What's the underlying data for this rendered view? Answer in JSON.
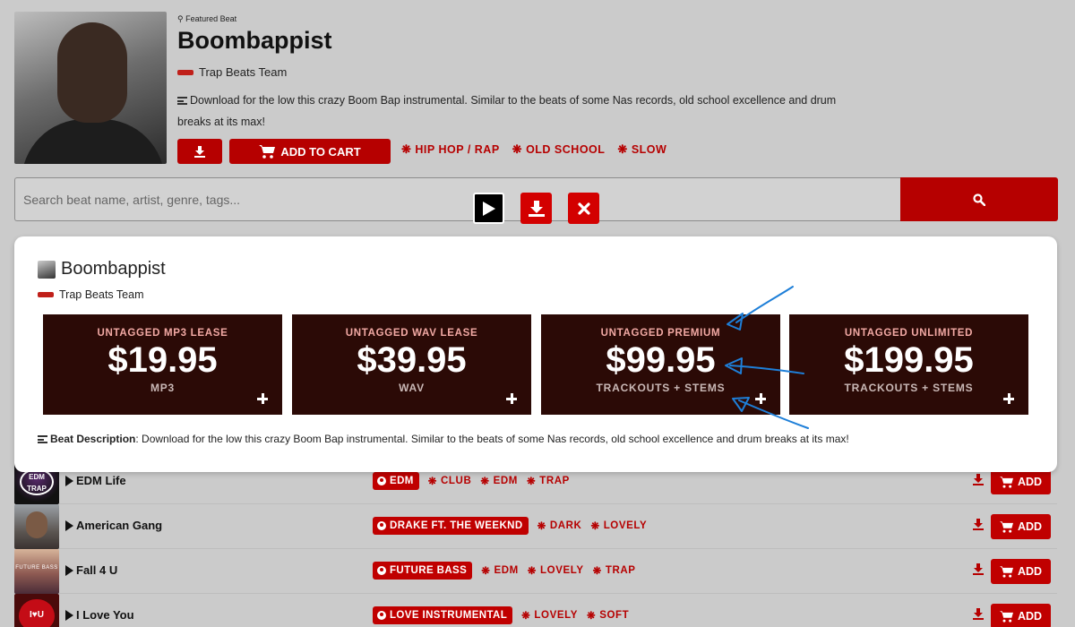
{
  "featured": {
    "label": "Featured Beat",
    "title": "Boombappist",
    "producer": "Trap Beats Team",
    "description": "Download for the low this crazy Boom Bap instrumental. Similar to the beats of some Nas records, old school excellence and drum breaks at its max!",
    "add_to_cart_label": "ADD TO CART",
    "tags": [
      "HIP HOP / RAP",
      "OLD SCHOOL",
      "SLOW"
    ]
  },
  "search": {
    "placeholder": "Search beat name, artist, genre, tags..."
  },
  "modal": {
    "title": "Boombappist",
    "producer": "Trap Beats Team",
    "leases": [
      {
        "name": "UNTAGGED MP3 LEASE",
        "price": "$19.95",
        "files": "MP3"
      },
      {
        "name": "UNTAGGED WAV LEASE",
        "price": "$39.95",
        "files": "WAV"
      },
      {
        "name": "UNTAGGED PREMIUM",
        "price": "$99.95",
        "files": "TRACKOUTS + STEMS"
      },
      {
        "name": "UNTAGGED UNLIMITED",
        "price": "$199.95",
        "files": "TRACKOUTS + STEMS"
      }
    ],
    "description_label": "Beat Description",
    "description": ": Download for the low this crazy Boom Bap instrumental. Similar to the beats of some Nas records, old school excellence and drum breaks at its max!"
  },
  "tracks": [
    {
      "title": "EDM Life",
      "artist_tag": "EDM",
      "tags": [
        "CLUB",
        "EDM",
        "TRAP"
      ],
      "thumb_text": "EDM TRAP",
      "add_label": "ADD"
    },
    {
      "title": "American Gang",
      "artist_tag": "DRAKE FT. THE WEEKND",
      "tags": [
        "DARK",
        "LOVELY"
      ],
      "thumb_text": "",
      "add_label": "ADD"
    },
    {
      "title": "Fall 4 U",
      "artist_tag": "FUTURE BASS",
      "tags": [
        "EDM",
        "LOVELY",
        "TRAP"
      ],
      "thumb_text": "FUTURE BASS",
      "add_label": "ADD"
    },
    {
      "title": "I Love You",
      "artist_tag": "LOVE INSTRUMENTAL",
      "tags": [
        "LOVELY",
        "SOFT"
      ],
      "thumb_text": "I♥U",
      "add_label": "ADD"
    }
  ],
  "colors": {
    "accent": "#b60000",
    "lease_bg": "#2b0a06",
    "annotation": "#1e7fd8"
  }
}
